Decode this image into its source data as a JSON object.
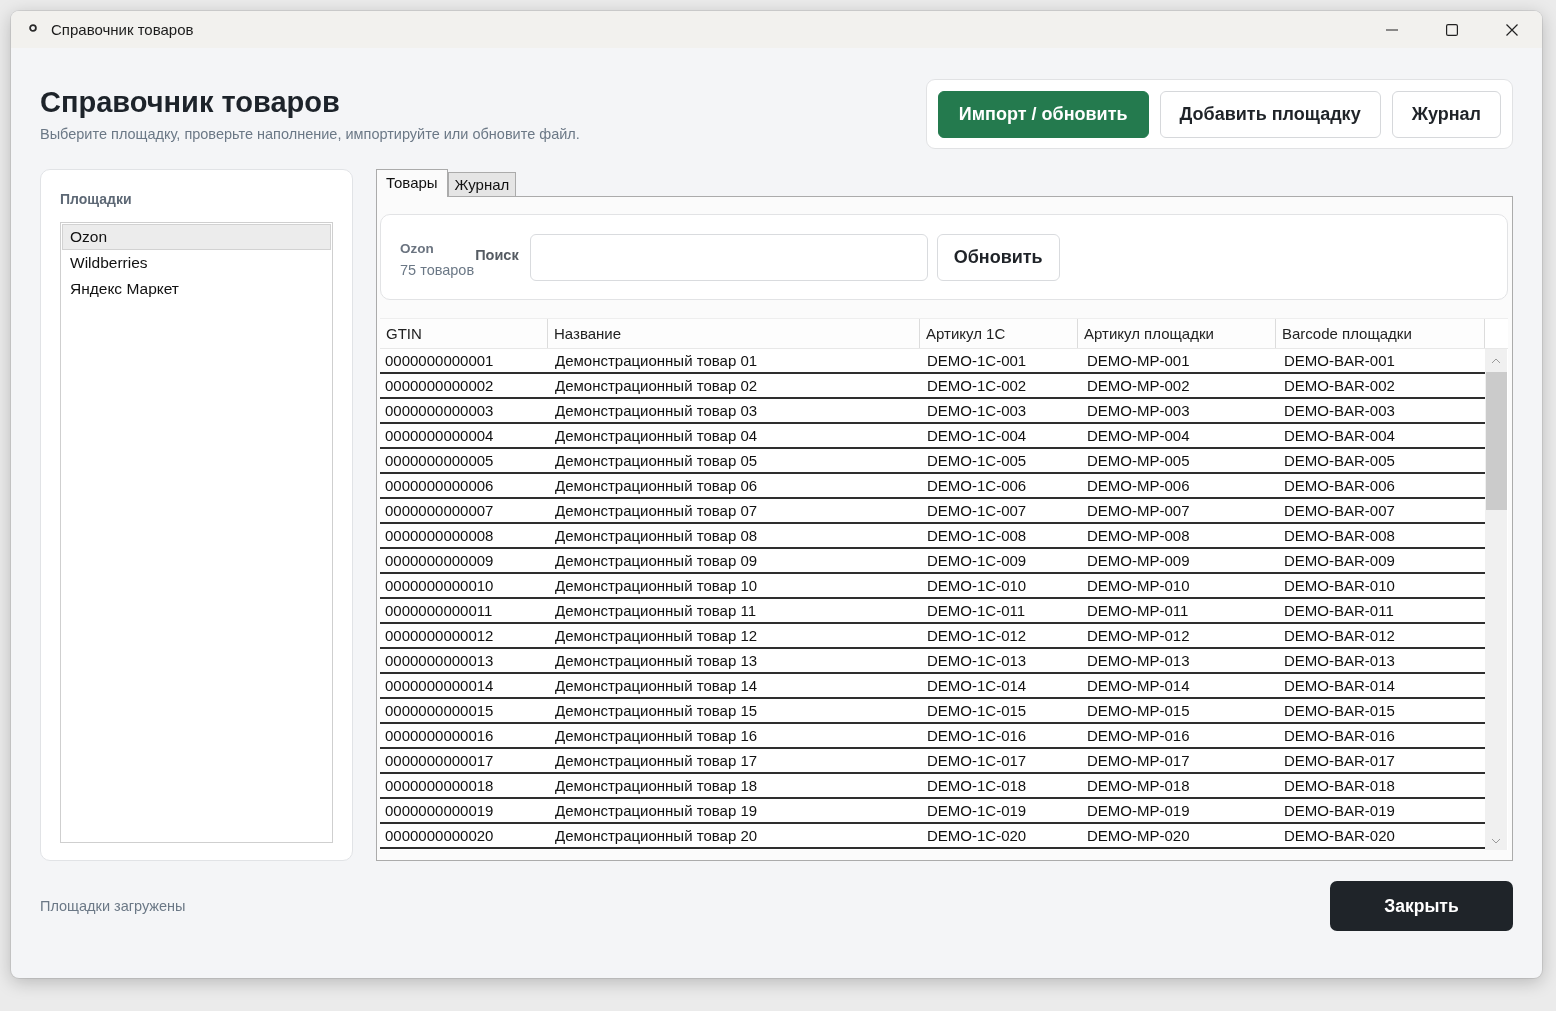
{
  "window": {
    "title": "Справочник товаров"
  },
  "header": {
    "title": "Справочник товаров",
    "subtitle": "Выберите площадку, проверьте наполнение, импортируйте или обновите файл."
  },
  "toolbar": {
    "buttons": [
      {
        "label": "Импорт / обновить",
        "kind": "primary"
      },
      {
        "label": "Добавить площадку",
        "kind": "secondary"
      },
      {
        "label": "Журнал",
        "kind": "secondary"
      }
    ]
  },
  "sidebar": {
    "title": "Площадки",
    "items": [
      {
        "label": "Ozon",
        "selected": true
      },
      {
        "label": "Wildberries",
        "selected": false
      },
      {
        "label": "Яндекс Маркет",
        "selected": false
      }
    ]
  },
  "tabs": [
    {
      "label": "Товары",
      "selected": true
    },
    {
      "label": "Журнал",
      "selected": false
    }
  ],
  "marketplace_panel": {
    "name": "Ozon",
    "count": "75 товаров",
    "search_label": "Поиск",
    "refresh_button": "Обновить"
  },
  "table": {
    "columns": [
      "GTIN",
      "Название",
      "Артикул 1С",
      "Артикул площадки",
      "Barcode площадки"
    ],
    "rows": [
      [
        "0000000000001",
        "Демонстрационный товар 01",
        "DEMO-1C-001",
        "DEMO-MP-001",
        "DEMO-BAR-001"
      ],
      [
        "0000000000002",
        "Демонстрационный товар 02",
        "DEMO-1C-002",
        "DEMO-MP-002",
        "DEMO-BAR-002"
      ],
      [
        "0000000000003",
        "Демонстрационный товар 03",
        "DEMO-1C-003",
        "DEMO-MP-003",
        "DEMO-BAR-003"
      ],
      [
        "0000000000004",
        "Демонстрационный товар 04",
        "DEMO-1C-004",
        "DEMO-MP-004",
        "DEMO-BAR-004"
      ],
      [
        "0000000000005",
        "Демонстрационный товар 05",
        "DEMO-1C-005",
        "DEMO-MP-005",
        "DEMO-BAR-005"
      ],
      [
        "0000000000006",
        "Демонстрационный товар 06",
        "DEMO-1C-006",
        "DEMO-MP-006",
        "DEMO-BAR-006"
      ],
      [
        "0000000000007",
        "Демонстрационный товар 07",
        "DEMO-1C-007",
        "DEMO-MP-007",
        "DEMO-BAR-007"
      ],
      [
        "0000000000008",
        "Демонстрационный товар 08",
        "DEMO-1C-008",
        "DEMO-MP-008",
        "DEMO-BAR-008"
      ],
      [
        "0000000000009",
        "Демонстрационный товар 09",
        "DEMO-1C-009",
        "DEMO-MP-009",
        "DEMO-BAR-009"
      ],
      [
        "0000000000010",
        "Демонстрационный товар 10",
        "DEMO-1C-010",
        "DEMO-MP-010",
        "DEMO-BAR-010"
      ],
      [
        "0000000000011",
        "Демонстрационный товар 11",
        "DEMO-1C-011",
        "DEMO-MP-011",
        "DEMO-BAR-011"
      ],
      [
        "0000000000012",
        "Демонстрационный товар 12",
        "DEMO-1C-012",
        "DEMO-MP-012",
        "DEMO-BAR-012"
      ],
      [
        "0000000000013",
        "Демонстрационный товар 13",
        "DEMO-1C-013",
        "DEMO-MP-013",
        "DEMO-BAR-013"
      ],
      [
        "0000000000014",
        "Демонстрационный товар 14",
        "DEMO-1C-014",
        "DEMO-MP-014",
        "DEMO-BAR-014"
      ],
      [
        "0000000000015",
        "Демонстрационный товар 15",
        "DEMO-1C-015",
        "DEMO-MP-015",
        "DEMO-BAR-015"
      ],
      [
        "0000000000016",
        "Демонстрационный товар 16",
        "DEMO-1C-016",
        "DEMO-MP-016",
        "DEMO-BAR-016"
      ],
      [
        "0000000000017",
        "Демонстрационный товар 17",
        "DEMO-1C-017",
        "DEMO-MP-017",
        "DEMO-BAR-017"
      ],
      [
        "0000000000018",
        "Демонстрационный товар 18",
        "DEMO-1C-018",
        "DEMO-MP-018",
        "DEMO-BAR-018"
      ],
      [
        "0000000000019",
        "Демонстрационный товар 19",
        "DEMO-1C-019",
        "DEMO-MP-019",
        "DEMO-BAR-019"
      ],
      [
        "0000000000020",
        "Демонстрационный товар 20",
        "DEMO-1C-020",
        "DEMO-MP-020",
        "DEMO-BAR-020"
      ]
    ]
  },
  "status_bar": {
    "text": "Площадки загружены"
  },
  "close_button": {
    "label": "Закрыть"
  }
}
